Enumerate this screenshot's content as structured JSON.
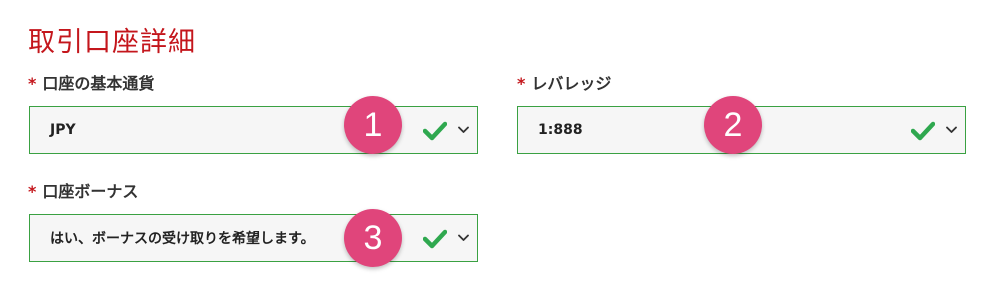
{
  "section": {
    "title": "取引口座詳細"
  },
  "required_mark": "*",
  "fields": [
    {
      "label": "口座の基本通貨",
      "value": "JPY",
      "badge": "1",
      "valid_icon": "check-icon",
      "dropdown_icon": "chevron-down-icon"
    },
    {
      "label": "レバレッジ",
      "value": "1:888",
      "badge": "2",
      "valid_icon": "check-icon",
      "dropdown_icon": "chevron-down-icon"
    },
    {
      "label": "口座ボーナス",
      "value": "はい、ボーナスの受け取りを希望します。",
      "badge": "3",
      "valid_icon": "check-icon",
      "dropdown_icon": "chevron-down-icon"
    }
  ],
  "colors": {
    "title": "#c4161c",
    "required": "#c4161c",
    "border_valid": "#3aa142",
    "check": "#2fa84f",
    "badge": "#e0457b"
  }
}
